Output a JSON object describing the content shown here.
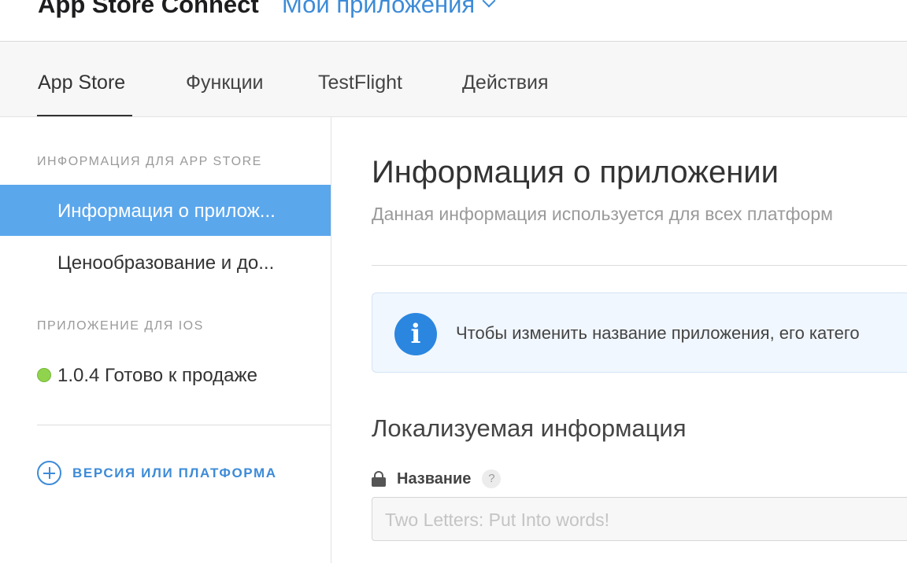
{
  "topbar": {
    "brand": "App Store Connect",
    "apps_menu_label": "Мои приложения"
  },
  "tabs": [
    {
      "label": "App Store",
      "active": true
    },
    {
      "label": "Функции",
      "active": false
    },
    {
      "label": "TestFlight",
      "active": false
    },
    {
      "label": "Действия",
      "active": false
    }
  ],
  "sidebar": {
    "section_app_store": "ИНФОРМАЦИЯ ДЛЯ APP STORE",
    "items": [
      {
        "label": "Информация о прилож...",
        "selected": true
      },
      {
        "label": "Ценообразование и до...",
        "selected": false
      }
    ],
    "section_ios": "ПРИЛОЖЕНИЕ ДЛЯ IOS",
    "version_status": {
      "label": "1.0.4 Готово к продаже",
      "status_color": "#8fd44c"
    },
    "add_version_label": "ВЕРСИЯ ИЛИ ПЛАТФОРМА"
  },
  "main": {
    "title": "Информация о приложении",
    "subtitle": "Данная информация используется для всех платформ",
    "info_box": {
      "icon": "info-icon",
      "text": "Чтобы изменить название приложения, его катего"
    },
    "localizable_title": "Локализуемая информация",
    "name_field": {
      "label": "Название",
      "help": "?",
      "value": "Two Letters: Put Into words!"
    }
  },
  "colors": {
    "accent": "#3d8bd8",
    "selected_bg": "#5ba7ec",
    "info_icon": "#2b86e0",
    "status_ready": "#8fd44c"
  }
}
